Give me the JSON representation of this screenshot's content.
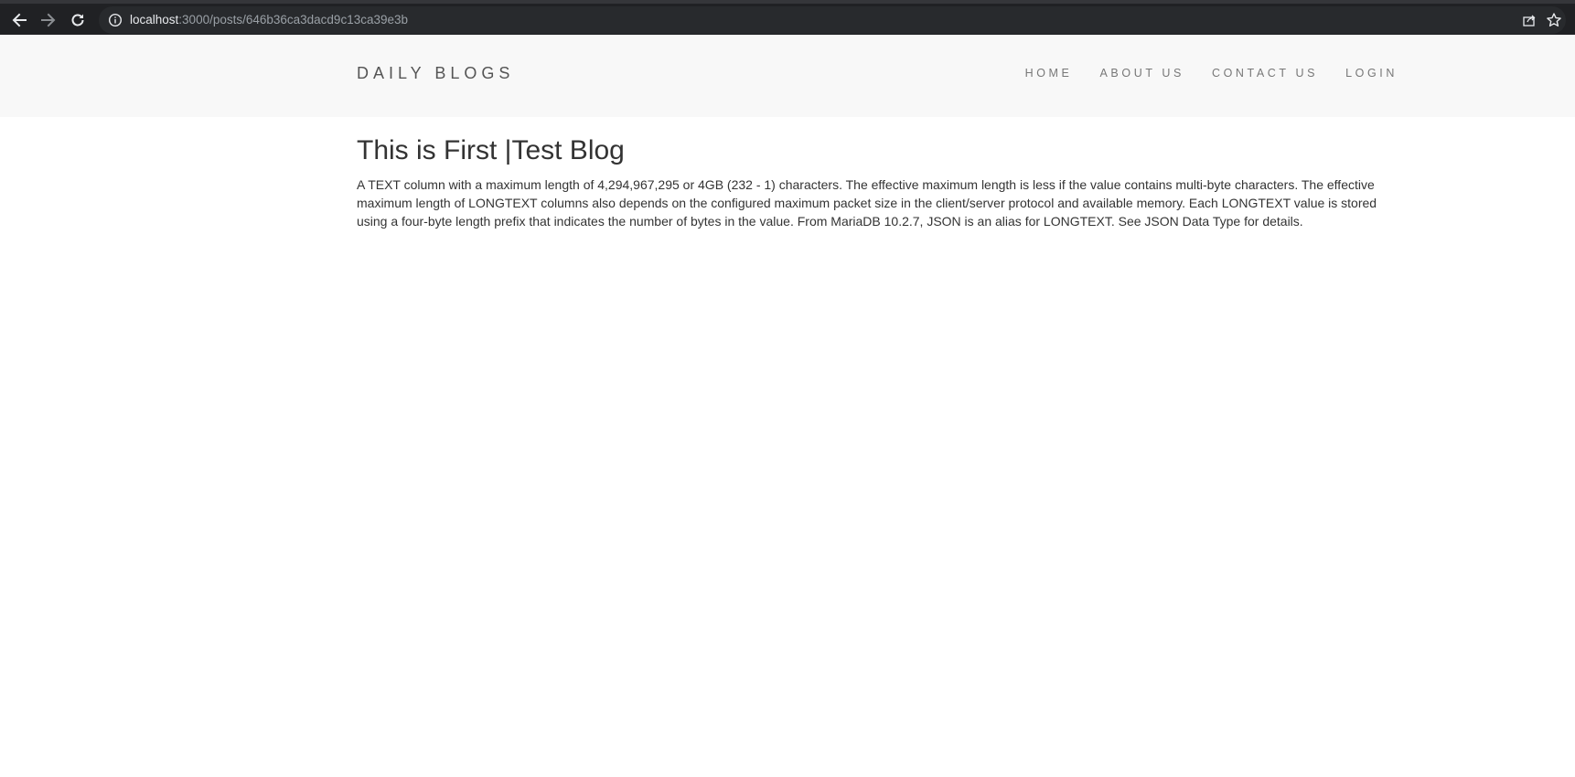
{
  "browser": {
    "url_host": "localhost",
    "url_path": ":3000/posts/646b36ca3dacd9c13ca39e3b",
    "icons": [
      "back-arrow-icon",
      "forward-arrow-icon",
      "reload-icon",
      "info-icon",
      "share-icon",
      "star-icon"
    ]
  },
  "header": {
    "brand": "DAILY BLOGS",
    "nav": [
      {
        "label": "HOME"
      },
      {
        "label": "ABOUT US"
      },
      {
        "label": "CONTACT US"
      },
      {
        "label": "LOGIN"
      }
    ]
  },
  "post": {
    "title": "This is First |Test Blog",
    "body": "A TEXT column with a maximum length of 4,294,967,295 or 4GB (232 - 1) characters. The effective maximum length is less if the value contains multi-byte characters. The effective maximum length of LONGTEXT columns also depends on the configured maximum packet size in the client/server protocol and available memory. Each LONGTEXT value is stored using a four-byte length prefix that indicates the number of bytes in the value. From MariaDB 10.2.7, JSON is an alias for LONGTEXT. See JSON Data Type for details."
  },
  "colors": {
    "chrome_bg": "#202124",
    "omnibox_bg": "#282a2d",
    "header_bg": "#f8f8f8",
    "text": "#333333"
  }
}
